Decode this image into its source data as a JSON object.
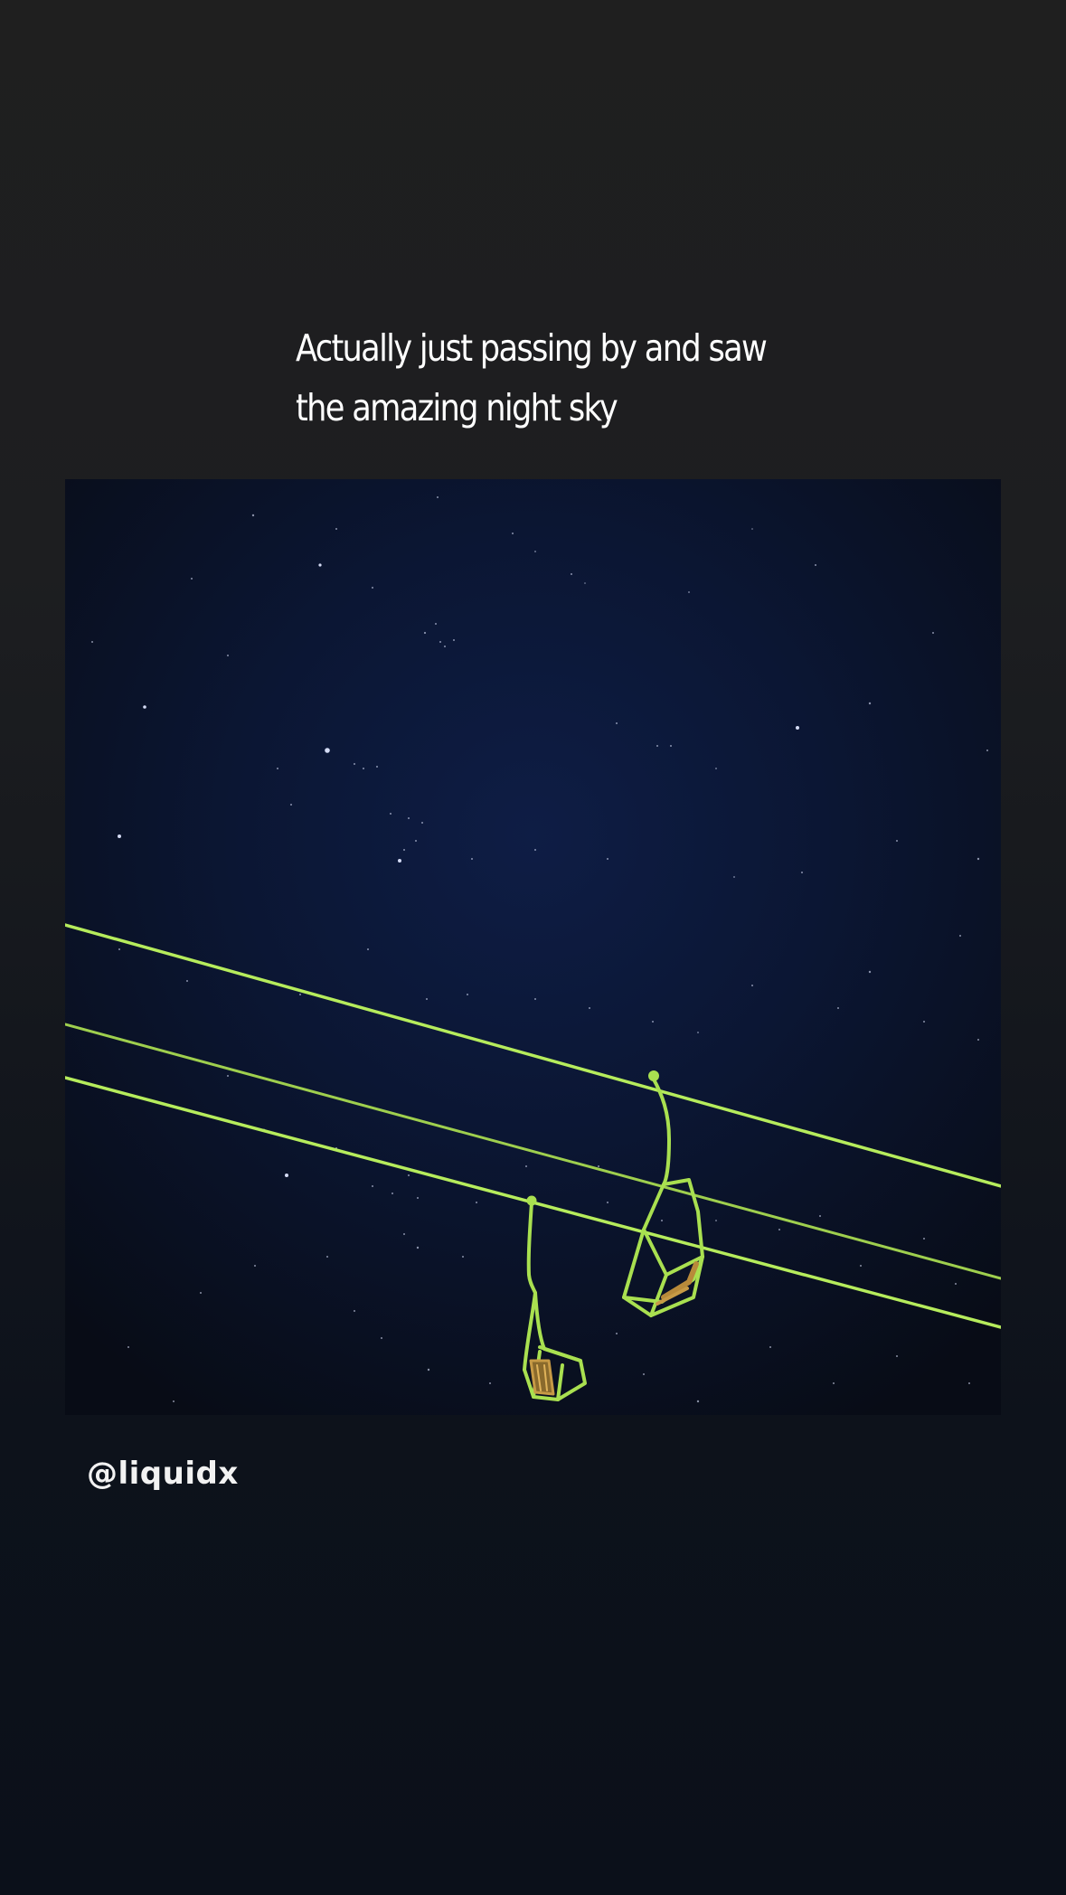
{
  "story": {
    "caption_lines": [
      "Actually just passing by and saw",
      "the amazing night sky"
    ],
    "username": "@liquidx",
    "photo": {
      "subject": "ski-lift-chairs-under-night-sky",
      "colors": {
        "sky_center": "#0e1d45",
        "sky_edge": "#080c16",
        "cable": "#b6ec5c",
        "chair": "#a9e050",
        "chair_seat": "#b88a3a"
      }
    }
  }
}
